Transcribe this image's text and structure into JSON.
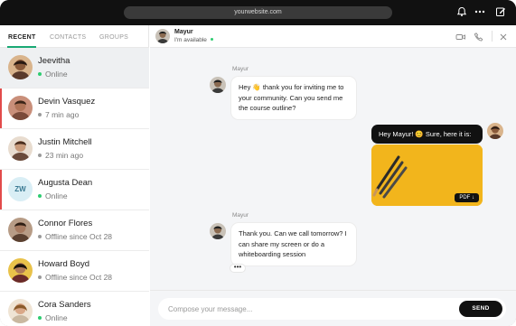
{
  "browser": {
    "url": "yourwebsite.com",
    "icons": [
      "bell-icon",
      "more-icon",
      "compose-icon"
    ]
  },
  "sidebar": {
    "tabs": [
      {
        "label": "RECENT",
        "active": true
      },
      {
        "label": "CONTACTS",
        "active": false
      },
      {
        "label": "GROUPS",
        "active": false
      }
    ],
    "contacts": [
      {
        "name": "Jeevitha",
        "status": "Online",
        "status_color": "#2ecc71",
        "avatar": "photo",
        "selected": true,
        "unread": false
      },
      {
        "name": "Devin Vasquez",
        "status": "7 min ago",
        "status_color": "#9a9a9a",
        "avatar": "photo",
        "selected": false,
        "unread": true
      },
      {
        "name": "Justin Mitchell",
        "status": "23 min ago",
        "status_color": "#9a9a9a",
        "avatar": "photo",
        "selected": false,
        "unread": false
      },
      {
        "name": "Augusta Dean",
        "status": "Online",
        "status_color": "#2ecc71",
        "avatar": "initials",
        "initials": "ZW",
        "selected": false,
        "unread": true
      },
      {
        "name": "Connor Flores",
        "status": "Offline since Oct 28",
        "status_color": "#9a9a9a",
        "avatar": "photo",
        "selected": false,
        "unread": false
      },
      {
        "name": "Howard Boyd",
        "status": "Offline since Oct 28",
        "status_color": "#9a9a9a",
        "avatar": "photo",
        "selected": false,
        "unread": false
      },
      {
        "name": "Cora Sanders",
        "status": "Online",
        "status_color": "#2ecc71",
        "avatar": "photo",
        "selected": false,
        "unread": false
      }
    ]
  },
  "chat": {
    "header": {
      "name": "Mayur",
      "status": "I'm available",
      "status_color": "#2ecc71",
      "icons": [
        "video-call-icon",
        "phone-icon",
        "close-icon"
      ]
    },
    "messages": [
      {
        "direction": "in",
        "sender": "Mayur",
        "text": "Hey 👋 thank you for inviting me to your community. Can you send me the course outline?"
      },
      {
        "direction": "out",
        "text": "Hey Mayur! 😊 Sure, here it is:"
      },
      {
        "direction": "out",
        "attachment": {
          "type": "image",
          "chip_label": "PDF"
        }
      },
      {
        "direction": "in",
        "sender": "Mayur",
        "text": "Thank you. Can we call tomorrow? I can share my screen or do a whiteboarding session"
      }
    ],
    "typing_indicator": "•••",
    "composer": {
      "placeholder": "Compose your message...",
      "send_label": "SEND"
    }
  },
  "colors": {
    "accent_green": "#19a974",
    "online": "#2ecc71",
    "unread_marker": "#e24b4b",
    "attachment_yellow": "#f2b51c"
  }
}
